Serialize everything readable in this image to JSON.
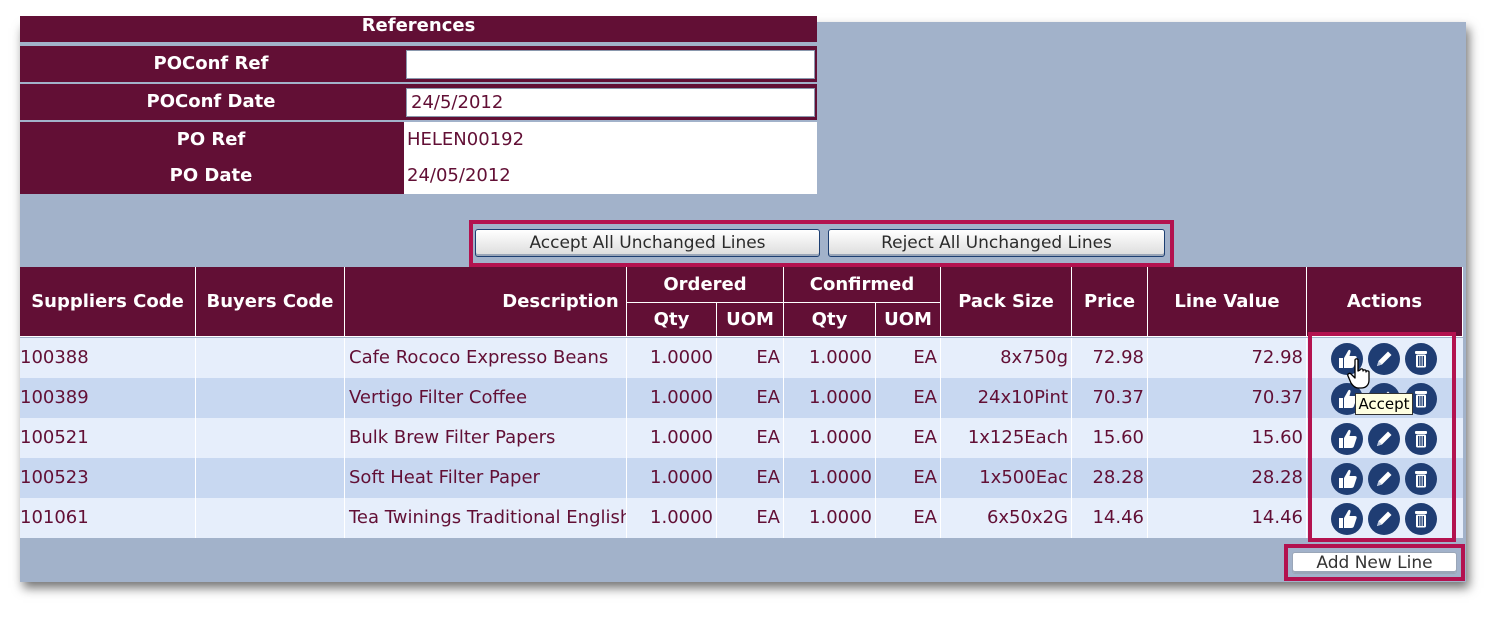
{
  "references": {
    "title": "References",
    "poconf_ref_label": "POConf Ref",
    "poconf_ref_value": "",
    "poconf_date_label": "POConf Date",
    "poconf_date_value": "24/5/2012",
    "po_ref_label": "PO Ref",
    "po_ref_value": "HELEN00192",
    "po_date_label": "PO Date",
    "po_date_value": "24/05/2012"
  },
  "bulk_actions": {
    "accept_label": "Accept All Unchanged Lines",
    "reject_label": "Reject All Unchanged Lines"
  },
  "table": {
    "headers": {
      "suppliers_code": "Suppliers Code",
      "buyers_code": "Buyers Code",
      "description": "Description",
      "ordered": "Ordered",
      "confirmed": "Confirmed",
      "qty": "Qty",
      "uom": "UOM",
      "pack_size": "Pack Size",
      "price": "Price",
      "line_value": "Line Value",
      "actions": "Actions"
    },
    "rows": [
      {
        "suppliers_code": "100388",
        "buyers_code": "",
        "description": "Cafe Rococo Expresso Beans",
        "ordered_qty": "1.0000",
        "ordered_uom": "EA",
        "confirmed_qty": "1.0000",
        "confirmed_uom": "EA",
        "pack_size": "8x750g",
        "price": "72.98",
        "line_value": "72.98"
      },
      {
        "suppliers_code": "100389",
        "buyers_code": "",
        "description": "Vertigo Filter Coffee",
        "ordered_qty": "1.0000",
        "ordered_uom": "EA",
        "confirmed_qty": "1.0000",
        "confirmed_uom": "EA",
        "pack_size": "24x10Pint",
        "price": "70.37",
        "line_value": "70.37"
      },
      {
        "suppliers_code": "100521",
        "buyers_code": "",
        "description": "Bulk Brew Filter Papers",
        "ordered_qty": "1.0000",
        "ordered_uom": "EA",
        "confirmed_qty": "1.0000",
        "confirmed_uom": "EA",
        "pack_size": "1x125Each",
        "price": "15.60",
        "line_value": "15.60"
      },
      {
        "suppliers_code": "100523",
        "buyers_code": "",
        "description": "Soft Heat Filter Paper",
        "ordered_qty": "1.0000",
        "ordered_uom": "EA",
        "confirmed_qty": "1.0000",
        "confirmed_uom": "EA",
        "pack_size": "1x500Eac",
        "price": "28.28",
        "line_value": "28.28"
      },
      {
        "suppliers_code": "101061",
        "buyers_code": "",
        "description": "Tea Twinings Traditional English",
        "ordered_qty": "1.0000",
        "ordered_uom": "EA",
        "confirmed_qty": "1.0000",
        "confirmed_uom": "EA",
        "pack_size": "6x50x2G",
        "price": "14.46",
        "line_value": "14.46"
      }
    ]
  },
  "tooltip": "Accept",
  "add_line_label": "Add New Line",
  "colors": {
    "header": "#620f35",
    "panel": "#a2b2ca",
    "row_even": "#e6eefb",
    "row_odd": "#c8d8f1",
    "highlight": "#b3124f",
    "icon": "#1f3d73"
  },
  "icons": [
    "thumbs-up-icon",
    "pencil-icon",
    "trash-icon"
  ]
}
